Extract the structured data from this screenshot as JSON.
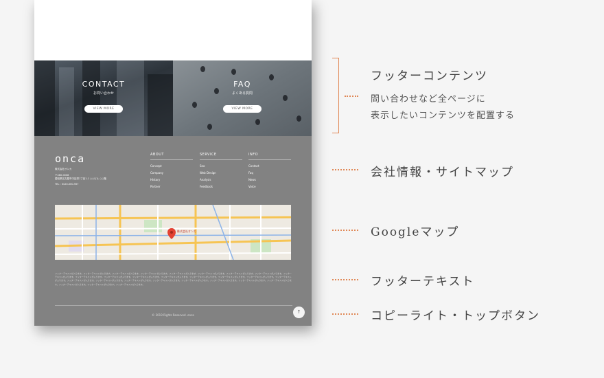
{
  "cta": {
    "contact": {
      "title": "CONTACT",
      "subtitle": "お問い合わせ",
      "button": "VIEW MORE"
    },
    "faq": {
      "title": "FAQ",
      "subtitle": "よくある質問",
      "button": "VIEW MORE"
    }
  },
  "footer": {
    "logo": "onca",
    "company_name": "株式会社オンカ",
    "postal": "〒460-0008",
    "address": "愛知県名古屋市中区栄1丁目1-1 ○○ビル ○○階",
    "tel": "TEL : 0120-000-557",
    "columns": [
      {
        "heading": "ABOUT",
        "items": [
          "Concept",
          "Company",
          "History",
          "Partner"
        ]
      },
      {
        "heading": "SERVICE",
        "items": [
          "Seo",
          "Web Design",
          "Analysis",
          "Feedback"
        ]
      },
      {
        "heading": "INFO",
        "items": [
          "Contact",
          "Faq",
          "News",
          "Voice"
        ]
      }
    ],
    "text": "フッターテキストが入ります。フッターテキストが入ります。フッターテキストが入ります。フッターテキストが入ります。フッターテキストが入ります。フッターテキストが入ります。フッターテキストが入ります。フッターテキストが入ります。フッターテキストが入ります。フッターテキストが入ります。フッターテキストが入ります。フッターテキストが入ります。フッターテキストが入ります。フッターテキストが入ります。フッターテキストが入ります。フッターテキストが入ります。フッターテキストが入ります。フッターテキストが入ります。フッターテキストが入ります。フッターテキストが入ります。フッターテキストが入ります。フッターテキストが入ります。フッターテキストが入ります。フッターテキストが入ります。フッターテキストが入ります。フッターテキストが入ります。フッターテキストが入ります。フッターテキストが入ります。",
    "copyright": "© 2019 Rights Reserved. onca",
    "top_button": "↑"
  },
  "map": {
    "marker_label": "株式会社オンカ"
  },
  "annotations": {
    "footer_contents": {
      "title": "フッターコンテンツ",
      "line1": "問い合わせなど全ページに",
      "line2": "表示したいコンテンツを配置する"
    },
    "company_sitemap": "会社情報・サイトマップ",
    "google_map": "Googleマップ",
    "footer_text": "フッターテキスト",
    "copyright_top": "コピーライト・トップボタン"
  },
  "colors": {
    "accent": "#e08856",
    "footer_bg": "#828282",
    "page_bg": "#f5f5f5"
  }
}
